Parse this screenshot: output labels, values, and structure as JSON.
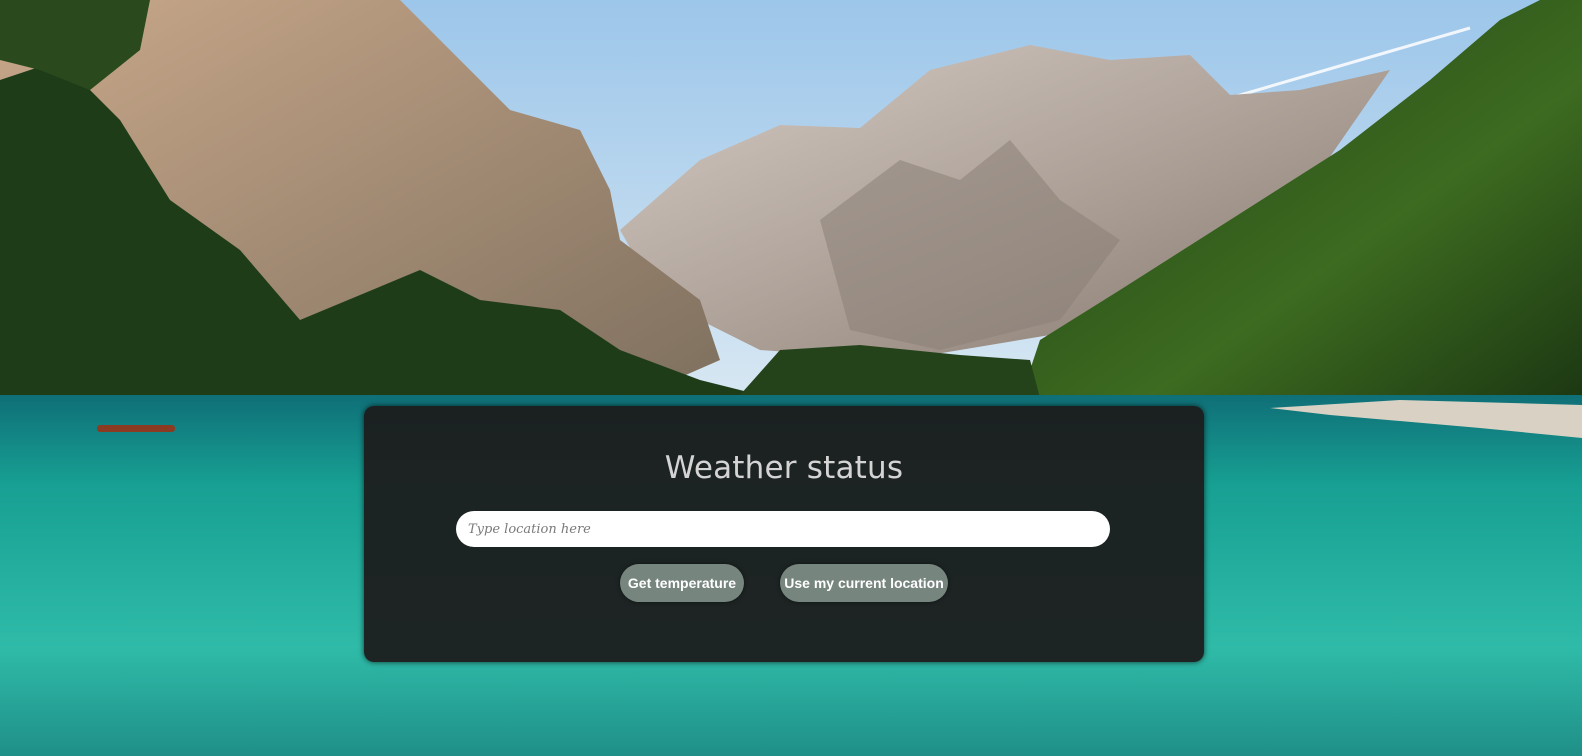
{
  "background": {
    "scene": "mountain-lake-icon",
    "colors": {
      "sky": "#bcd8ee",
      "water": "#18a79a",
      "forest": "#1f4a1c",
      "rock": "#b8aca2"
    }
  },
  "panel": {
    "title": "Weather status",
    "search": {
      "value": "",
      "placeholder": "Type location here"
    },
    "buttons": {
      "get_temperature": "Get temperature",
      "use_location": "Use my current location"
    },
    "colors": {
      "panel_bg": "#1c1c1c",
      "button_bg": "#77857f",
      "title": "#d4d4d4"
    }
  }
}
